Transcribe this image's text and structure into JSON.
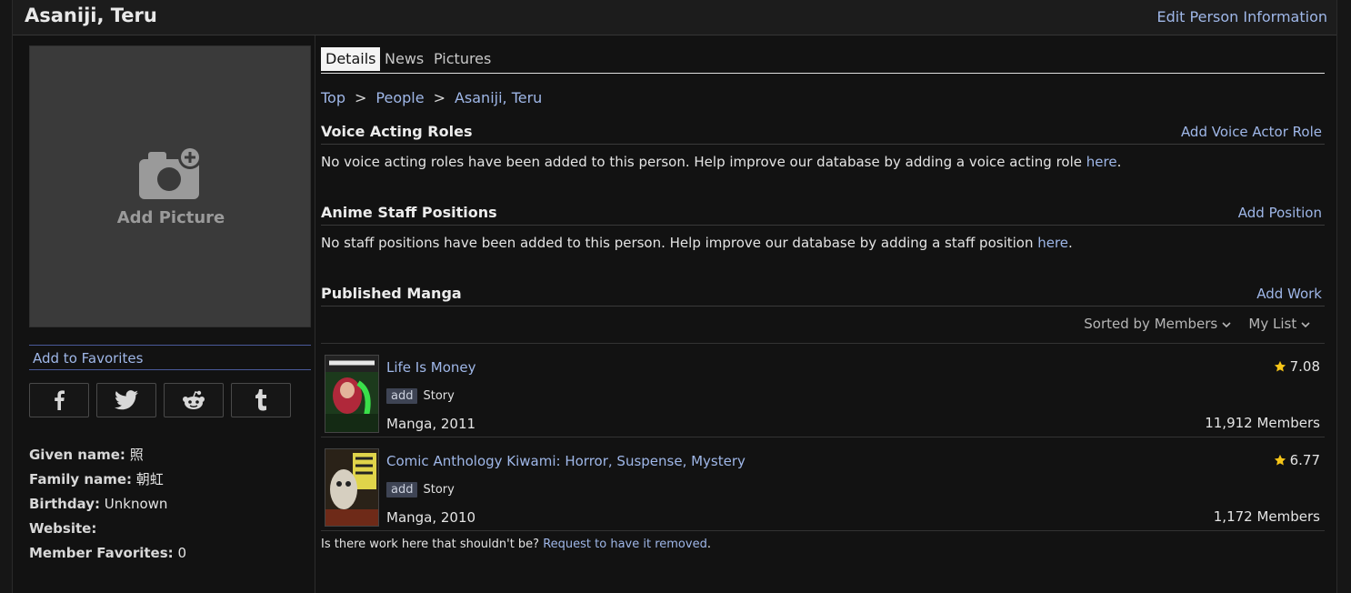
{
  "header": {
    "name": "Asaniji, Teru",
    "edit_link": "Edit Person Information"
  },
  "sidebar": {
    "add_picture": "Add Picture",
    "add_to_favorites": "Add to Favorites",
    "share": [
      "facebook-icon",
      "twitter-icon",
      "reddit-icon",
      "tumblr-icon"
    ],
    "info": [
      {
        "key": "Given name:",
        "value": "照"
      },
      {
        "key": "Family name:",
        "value": "朝虹"
      },
      {
        "key": "Birthday:",
        "value": "Unknown"
      },
      {
        "key": "Website:",
        "value": ""
      },
      {
        "key": "Member Favorites:",
        "value": "0"
      }
    ]
  },
  "tabs": [
    "Details",
    "News",
    "Pictures"
  ],
  "breadcrumb": [
    "Top",
    "People",
    "Asaniji, Teru"
  ],
  "breadcrumb_sep": ">",
  "voice": {
    "title": "Voice Acting Roles",
    "action": "Add Voice Actor Role",
    "msg": "No voice acting roles have been added to this person. Help improve our database by adding a voice acting role ",
    "msg_link": "here",
    "msg_end": "."
  },
  "staff": {
    "title": "Anime Staff Positions",
    "action": "Add Position",
    "msg": "No staff positions have been added to this person. Help improve our database by adding a staff position ",
    "msg_link": "here",
    "msg_end": "."
  },
  "manga": {
    "title": "Published Manga",
    "action": "Add Work",
    "sort_label": "Sorted by Members",
    "list_label": "My List",
    "items": [
      {
        "title": "Life Is Money",
        "tag": "add",
        "role": "Story",
        "type": "Manga, 2011",
        "score": "7.08",
        "members": "11,912 Members"
      },
      {
        "title": "Comic Anthology Kiwami: Horror, Suspense, Mystery",
        "tag": "add",
        "role": "Story",
        "type": "Manga, 2010",
        "score": "6.77",
        "members": "1,172 Members"
      }
    ],
    "removal_q": "Is there work here that shouldn't be?",
    "removal_link": "Request to have it removed",
    "removal_end": "."
  },
  "colors": {
    "link": "#9fb7e8",
    "background": "#121212",
    "star": "#f5c518"
  }
}
